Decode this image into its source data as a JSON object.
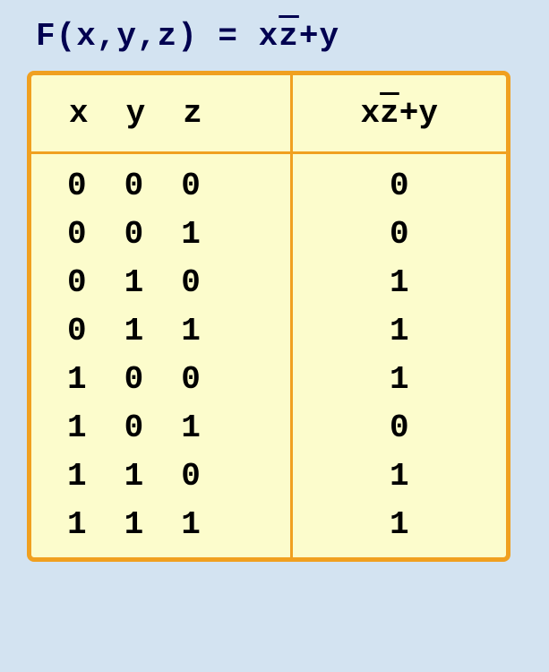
{
  "title": {
    "prefix": "F(x,y,z) = x",
    "overline": "z",
    "suffix": "+y"
  },
  "headers": {
    "x": "x",
    "y": "y",
    "z": "z",
    "result_prefix": "x",
    "result_overline": "z",
    "result_suffix": "+y"
  },
  "chart_data": {
    "type": "table",
    "title": "Truth table for F(x,y,z) = x·z̄ + y",
    "columns": [
      "x",
      "y",
      "z",
      "xz̄+y"
    ],
    "rows": [
      {
        "x": "0",
        "y": "0",
        "z": "0",
        "result": "0"
      },
      {
        "x": "0",
        "y": "0",
        "z": "1",
        "result": "0"
      },
      {
        "x": "0",
        "y": "1",
        "z": "0",
        "result": "1"
      },
      {
        "x": "0",
        "y": "1",
        "z": "1",
        "result": "1"
      },
      {
        "x": "1",
        "y": "0",
        "z": "0",
        "result": "1"
      },
      {
        "x": "1",
        "y": "0",
        "z": "1",
        "result": "0"
      },
      {
        "x": "1",
        "y": "1",
        "z": "0",
        "result": "1"
      },
      {
        "x": "1",
        "y": "1",
        "z": "1",
        "result": "1"
      }
    ]
  }
}
